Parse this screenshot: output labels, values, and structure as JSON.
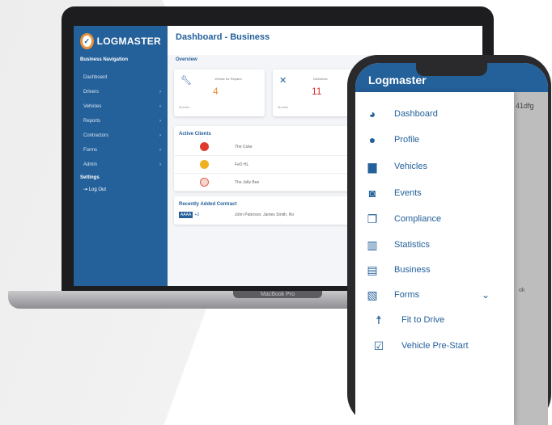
{
  "laptop": {
    "brand_label": "MacBook Pro",
    "sidebar": {
      "logo_text": "LOGMASTER",
      "heading": "Business Navigation",
      "items": [
        {
          "label": "Dashboard"
        },
        {
          "label": "Drivers"
        },
        {
          "label": "Vehicles"
        },
        {
          "label": "Reports"
        },
        {
          "label": "Contractors"
        },
        {
          "label": "Forms"
        },
        {
          "label": "Admin"
        }
      ],
      "settings_heading": "Settings",
      "logout_label": "Log Out"
    },
    "main": {
      "title": "Dashboard - Business",
      "overview_label": "Overview",
      "cards": [
        {
          "title": "Vehicle for Repairs",
          "value": "4",
          "sub": "Months"
        },
        {
          "title": "Deliveries",
          "value": "11",
          "sub": "Months"
        }
      ],
      "active_clients": {
        "title": "Active Clients",
        "clients": [
          {
            "name": "The Coke",
            "color": "#e03a2f"
          },
          {
            "name": "FeD HL",
            "color": "#f2b01e"
          },
          {
            "name": "The Jolly Bee",
            "color": "#f4d6d0"
          }
        ]
      },
      "contract": {
        "title": "Recently Added Contract",
        "badge": "AAAA",
        "plus": "+3",
        "names": "John Paterson, James Smith, Ro"
      }
    }
  },
  "phone": {
    "title": "Logmaster",
    "backdrop_id": "41dfg",
    "backdrop_text": "ok",
    "menu": [
      {
        "label": "Dashboard",
        "icon": "speedometer-icon",
        "glyph": "◕"
      },
      {
        "label": "Profile",
        "icon": "user-circle-icon",
        "glyph": "●"
      },
      {
        "label": "Vehicles",
        "icon": "truck-icon",
        "glyph": "▆"
      },
      {
        "label": "Events",
        "icon": "calendar-user-icon",
        "glyph": "◙"
      },
      {
        "label": "Compliance",
        "icon": "document-edit-icon",
        "glyph": "❐"
      },
      {
        "label": "Statistics",
        "icon": "bar-chart-icon",
        "glyph": "▥"
      },
      {
        "label": "Business",
        "icon": "building-icon",
        "glyph": "▤"
      },
      {
        "label": "Forms",
        "icon": "form-icon",
        "glyph": "▧"
      },
      {
        "label": "Fit to Drive",
        "icon": "person-icon",
        "glyph": "☨"
      },
      {
        "label": "Vehicle Pre-Start",
        "icon": "checkbox-icon",
        "glyph": "☑"
      }
    ],
    "forms_chevron": "⌄"
  },
  "colors": {
    "brand_blue": "#24609a",
    "accent_orange": "#e8913a",
    "alert_red": "#d2322d"
  }
}
